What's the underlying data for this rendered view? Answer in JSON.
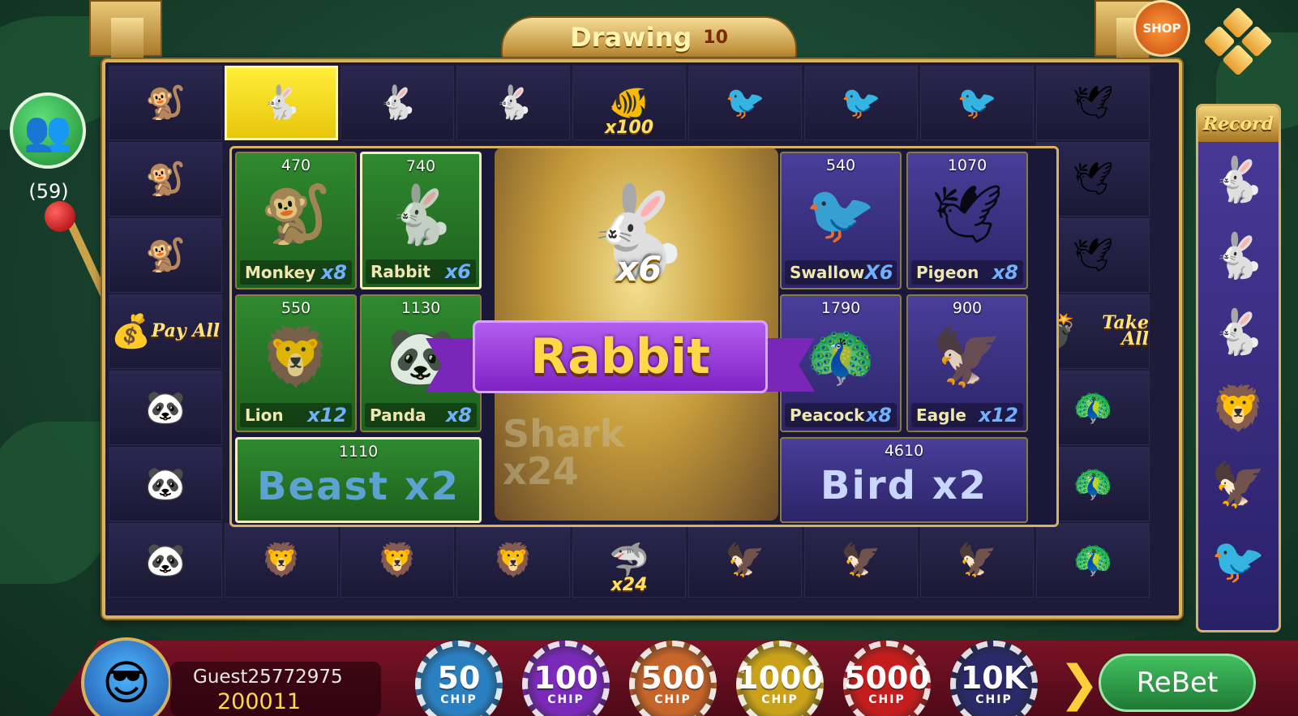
{
  "header": {
    "status": "Drawing",
    "countdown": "10",
    "shop_label": "SHOP"
  },
  "players": {
    "count": "(59)"
  },
  "ring": {
    "top": [
      {
        "icon": "🐒",
        "name": "monkey-cell",
        "mult": ""
      },
      {
        "icon": "🐇",
        "name": "rabbit-cell-highlighted",
        "mult": ""
      },
      {
        "icon": "🐇",
        "name": "rabbit-cell",
        "mult": ""
      },
      {
        "icon": "🐇",
        "name": "rabbit-cell",
        "mult": ""
      },
      {
        "icon": "🐠",
        "name": "gold-fish-cell",
        "mult": "x100"
      },
      {
        "icon": "🐦",
        "name": "swallow-cell",
        "mult": ""
      },
      {
        "icon": "🐦",
        "name": "swallow-cell",
        "mult": ""
      },
      {
        "icon": "🐦",
        "name": "swallow-cell",
        "mult": ""
      },
      {
        "icon": "🕊",
        "name": "pigeon-cell",
        "mult": ""
      }
    ],
    "left": [
      {
        "icon": "🐒",
        "name": "monkey-cell"
      },
      {
        "icon": "🐒",
        "name": "monkey-cell"
      },
      {
        "icon": "💰",
        "name": "pay-all-cell",
        "text": "Pay All"
      },
      {
        "icon": "🐼",
        "name": "panda-cell"
      },
      {
        "icon": "🐼",
        "name": "panda-cell"
      }
    ],
    "right": [
      {
        "icon": "🕊",
        "name": "pigeon-cell"
      },
      {
        "icon": "🕊",
        "name": "pigeon-cell"
      },
      {
        "icon": "💣",
        "name": "take-all-cell",
        "text": "Take All"
      },
      {
        "icon": "🦚",
        "name": "peacock-cell"
      },
      {
        "icon": "🦚",
        "name": "peacock-cell"
      }
    ],
    "bottom": [
      {
        "icon": "🐼",
        "name": "panda-cell",
        "mult": ""
      },
      {
        "icon": "🦁",
        "name": "lion-cell",
        "mult": ""
      },
      {
        "icon": "🦁",
        "name": "lion-cell",
        "mult": ""
      },
      {
        "icon": "🦁",
        "name": "lion-cell",
        "mult": ""
      },
      {
        "icon": "🦈",
        "name": "shark-cell",
        "mult": "x24"
      },
      {
        "icon": "🦅",
        "name": "eagle-cell",
        "mult": ""
      },
      {
        "icon": "🦅",
        "name": "eagle-cell",
        "mult": ""
      },
      {
        "icon": "🦅",
        "name": "eagle-cell",
        "mult": ""
      },
      {
        "icon": "🦚",
        "name": "peacock-cell",
        "mult": ""
      }
    ]
  },
  "bets": {
    "monkey": {
      "amount": "470",
      "label": "Monkey",
      "mult": "x8",
      "icon": "🐒"
    },
    "rabbit": {
      "amount": "740",
      "label": "Rabbit",
      "mult": "x6",
      "icon": "🐇"
    },
    "swallow": {
      "amount": "540",
      "label": "Swallow",
      "mult": "X6",
      "icon": "🐦"
    },
    "pigeon": {
      "amount": "1070",
      "label": "Pigeon",
      "mult": "x8",
      "icon": "🕊"
    },
    "lion": {
      "amount": "550",
      "label": "Lion",
      "mult": "x12",
      "icon": "🦁"
    },
    "panda": {
      "amount": "1130",
      "label": "Panda",
      "mult": "x8",
      "icon": "🐼"
    },
    "peacock": {
      "amount": "1790",
      "label": "Peacock",
      "mult": "x8",
      "icon": "🦚"
    },
    "eagle": {
      "amount": "900",
      "label": "Eagle",
      "mult": "x12",
      "icon": "🦅"
    },
    "beast": {
      "amount": "1110",
      "label": "Beast   x2"
    },
    "bird": {
      "amount": "4610",
      "label": "Bird   x2"
    }
  },
  "result": {
    "icon": "🐇",
    "mult": "x6",
    "name": "Rabbit",
    "ghost_label": "Shark",
    "ghost_mult": "x24"
  },
  "record": {
    "title": "Record",
    "items": [
      "🐇",
      "🐇",
      "🐇",
      "🦁",
      "🦅",
      "🐦"
    ]
  },
  "user": {
    "name": "Guest25772975",
    "balance": "200011"
  },
  "chips": [
    {
      "value": "50",
      "label": "CHIP",
      "color": "#2a7fc0"
    },
    {
      "value": "100",
      "label": "CHIP",
      "color": "#7a2ab8"
    },
    {
      "value": "500",
      "label": "CHIP",
      "color": "#c5652a"
    },
    {
      "value": "1000",
      "label": "CHIP",
      "color": "#c9a21a"
    },
    {
      "value": "5000",
      "label": "CHIP",
      "color": "#c41d1d"
    },
    {
      "value": "10K",
      "label": "CHIP",
      "color": "#2a2a6a"
    }
  ],
  "rebet_label": "ReBet"
}
